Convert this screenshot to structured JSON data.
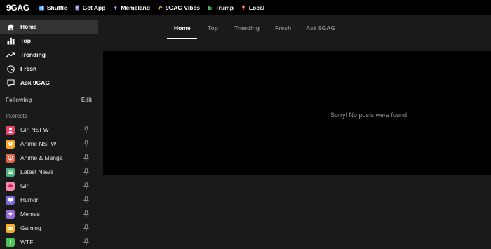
{
  "topbar": {
    "logo": "9GAG",
    "links": [
      {
        "label": "Shuffle",
        "icon": "shuffle-icon",
        "color": "#3f9bf5"
      },
      {
        "label": "Get App",
        "icon": "phone-icon",
        "color": "#9b7bd8"
      },
      {
        "label": "Memeland",
        "icon": "memeland-icon",
        "color": "#c98ef5"
      },
      {
        "label": "9GAG Vibes",
        "icon": "vibes-icon",
        "color": "#f5c542"
      },
      {
        "label": "Trump",
        "icon": "trump-icon",
        "color": "#4caf50"
      },
      {
        "label": "Local",
        "icon": "location-pin-icon",
        "color": "#e53935"
      }
    ]
  },
  "sidebar": {
    "nav": [
      {
        "label": "Home",
        "icon": "home-icon"
      },
      {
        "label": "Top",
        "icon": "top-icon"
      },
      {
        "label": "Trending",
        "icon": "trending-icon"
      },
      {
        "label": "Fresh",
        "icon": "clock-icon"
      },
      {
        "label": "Ask 9GAG",
        "icon": "chat-icon"
      }
    ],
    "following_label": "Following",
    "edit_label": "Edit",
    "interests_label": "Interests",
    "interests": [
      {
        "label": "Girl NSFW",
        "color": "#e5446d"
      },
      {
        "label": "Anime NSFW",
        "color": "#f5a623"
      },
      {
        "label": "Anime & Manga",
        "color": "#e0654a"
      },
      {
        "label": "Latest News",
        "color": "#4caf7d"
      },
      {
        "label": "Girl",
        "color": "#f28bb0"
      },
      {
        "label": "Humor",
        "color": "#7b6cd9"
      },
      {
        "label": "Memes",
        "color": "#9b6cd9"
      },
      {
        "label": "Gaming",
        "color": "#f5b023"
      },
      {
        "label": "WTF",
        "color": "#4cc25a"
      }
    ]
  },
  "tabs": [
    "Home",
    "Top",
    "Trending",
    "Fresh",
    "Ask 9GAG"
  ],
  "main": {
    "empty_message": "Sorry! No posts were found"
  }
}
